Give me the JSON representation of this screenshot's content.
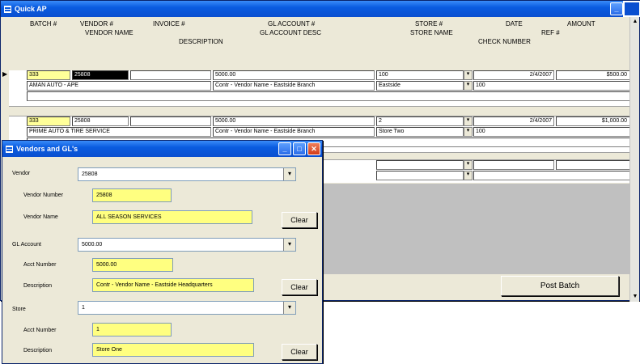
{
  "quick_ap": {
    "title": "Quick AP",
    "headers": {
      "batch": "BATCH #",
      "vendor_num": "VENDOR #",
      "invoice": "INVOICE #",
      "gl_account": "GL ACCOUNT #",
      "store_num": "STORE #",
      "date": "DATE",
      "amount": "AMOUNT",
      "vendor_name": "VENDOR NAME",
      "gl_account_desc": "GL ACCOUNT DESC",
      "store_name": "STORE NAME",
      "ref": "REF #",
      "description": "DESCRIPTION",
      "check_number": "CHECK NUMBER"
    },
    "records": [
      {
        "selector": "▶",
        "batch": "333",
        "vendor": "25808",
        "invoice": "",
        "gl": "5000.00",
        "store": "100",
        "date": "2/4/2007",
        "amount": "$500.00",
        "vendor_name": "AMAN AUTO - APE",
        "gl_desc": "Contr - Vendor Name - Eastside Branch",
        "store_name": "Eastside",
        "check": "100"
      },
      {
        "selector": "",
        "batch": "333",
        "vendor": "25808",
        "invoice": "",
        "gl": "5000.00",
        "store": "2",
        "date": "2/4/2007",
        "amount": "$1,000.00",
        "vendor_name": "PRIME AUTO & TIRE SERVICE",
        "gl_desc": "Contr - Vendor Name - Eastside Branch",
        "store_name": "Store Two",
        "check": "100"
      }
    ],
    "post_batch_label": "Post Batch"
  },
  "vendors_gl": {
    "title": "Vendors and GL's",
    "vendor_label": "Vendor",
    "vendor_value": "25808",
    "vendor_number_label": "Vendor Number",
    "vendor_number_value": "25808",
    "vendor_name_label": "Vendor Name",
    "vendor_name_value": "ALL SEASON SERVICES",
    "gl_account_label": "GL Account",
    "gl_account_value": "5000.00",
    "acct_number_label": "Acct Number",
    "acct_number_value": "5000.00",
    "description_label": "Description",
    "description_value": "Contr - Vendor Name - Eastside Headquarters",
    "store_label": "Store",
    "store_value": "1",
    "store_number_label": "Acct Number",
    "store_number_value": "1",
    "store_desc_label": "Description",
    "store_desc_value": "Store One",
    "clear_label": "Clear"
  }
}
